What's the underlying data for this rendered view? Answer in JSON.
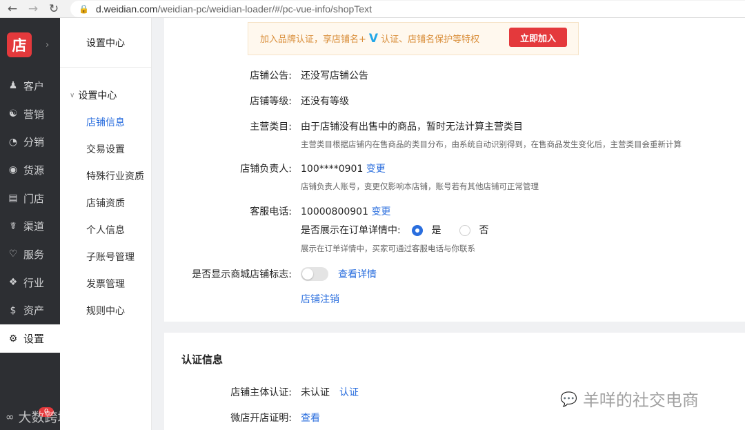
{
  "browser": {
    "back_icon": "arrow-left",
    "forward_icon": "arrow-right",
    "reload_icon": "reload",
    "url_host": "d.weidian.com",
    "url_path": "/weidian-pc/weidian-loader/#/pc-vue-info/shopText"
  },
  "app": {
    "logo_text": "店",
    "expand_icon": "chevron-right"
  },
  "sidebar": {
    "items": [
      {
        "label": "客户",
        "icon": "user-icon"
      },
      {
        "label": "营销",
        "icon": "megaphone-icon"
      },
      {
        "label": "分销",
        "icon": "pie-icon"
      },
      {
        "label": "货源",
        "icon": "source-icon"
      },
      {
        "label": "门店",
        "icon": "store-icon"
      },
      {
        "label": "渠道",
        "icon": "channel-icon"
      },
      {
        "label": "服务",
        "icon": "heart-icon"
      },
      {
        "label": "行业",
        "icon": "puzzle-icon"
      },
      {
        "label": "资产",
        "icon": "dollar-icon"
      },
      {
        "label": "设置",
        "icon": "gear-icon",
        "active": true
      }
    ],
    "badge": "0"
  },
  "subnav": {
    "title": "设置中心",
    "group": "设置中心",
    "items": [
      "店铺信息",
      "交易设置",
      "特殊行业资质",
      "店铺资质",
      "个人信息",
      "子账号管理",
      "发票管理",
      "规则中心"
    ],
    "active_index": 0
  },
  "banner": {
    "text_before": "加入品牌认证，享店铺名+",
    "v_mark": "V",
    "text_after": "认证、店铺名保护等特权",
    "button": "立即加入"
  },
  "shop": {
    "notice_label": "店铺公告:",
    "notice_value": "还没写店铺公告",
    "level_label": "店铺等级:",
    "level_value": "还没有等级",
    "category_label": "主营类目:",
    "category_value": "由于店铺没有出售中的商品，暂时无法计算主营类目",
    "category_hint": "主营类目根据店铺内在售商品的类目分布，由系统自动识别得到，在售商品发生变化后，主营类目会重新计算",
    "owner_label": "店铺负责人:",
    "owner_value": "100****0901",
    "owner_change": "变更",
    "owner_hint": "店铺负责人账号，变更仅影响本店铺，账号若有其他店铺可正常管理",
    "phone_label": "客服电话:",
    "phone_value": "10000800901",
    "phone_change": "变更",
    "show_in_order_label": "是否展示在订单详情中:",
    "option_yes": "是",
    "option_no": "否",
    "show_in_order_selected": "是",
    "show_hint": "展示在订单详情中，买家可通过客服电话与你联系",
    "mall_badge_label": "是否显示商城店铺标志:",
    "mall_badge_on": false,
    "mall_badge_details": "查看详情",
    "cancel_shop": "店铺注销"
  },
  "auth": {
    "title": "认证信息",
    "subject_label": "店铺主体认证:",
    "subject_value": "未认证",
    "subject_action": "认证",
    "proof_label": "微店开店证明:",
    "proof_action": "查看"
  },
  "watermarks": {
    "left": "大数跨境",
    "right": "羊咩的社交电商"
  }
}
